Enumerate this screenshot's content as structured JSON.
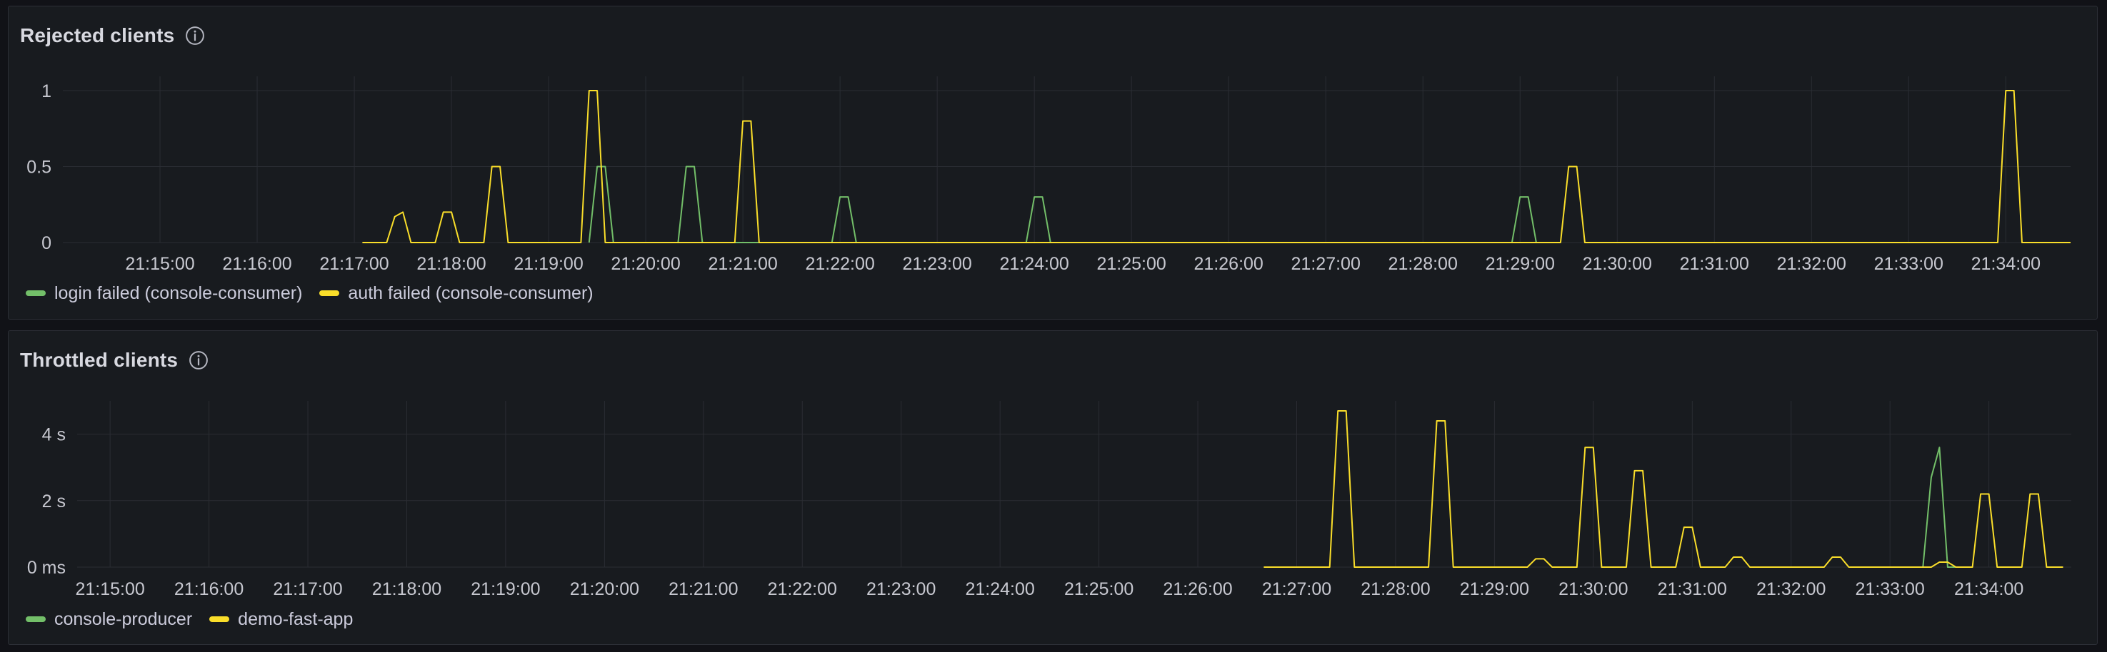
{
  "colors": {
    "background": "#111217",
    "panel": "#181b1f",
    "grid": "#2a2d33",
    "text": "#c7c8d0",
    "green": "#73bf69",
    "yellow": "#fade2a"
  },
  "panels": [
    {
      "id": "rejected",
      "title": "Rejected clients",
      "legend": [
        {
          "label": "login failed (console-consumer)",
          "color": "#73bf69"
        },
        {
          "label": "auth failed (console-consumer)",
          "color": "#fade2a"
        }
      ]
    },
    {
      "id": "throttled",
      "title": "Throttled clients",
      "legend": [
        {
          "label": "console-producer",
          "color": "#73bf69"
        },
        {
          "label": "demo-fast-app",
          "color": "#fade2a"
        }
      ]
    }
  ],
  "chart_data": [
    {
      "type": "line",
      "title": "Rejected clients",
      "x_range": [
        "21:14:00",
        "21:34:40"
      ],
      "x_ticks": [
        "21:15:00",
        "21:16:00",
        "21:17:00",
        "21:18:00",
        "21:19:00",
        "21:20:00",
        "21:21:00",
        "21:22:00",
        "21:23:00",
        "21:24:00",
        "21:25:00",
        "21:26:00",
        "21:27:00",
        "21:28:00",
        "21:29:00",
        "21:30:00",
        "21:31:00",
        "21:32:00",
        "21:33:00",
        "21:34:00"
      ],
      "y_ticks": [
        "0",
        "0.5",
        "1"
      ],
      "ylim": [
        0,
        1
      ],
      "grid": true,
      "legend_position": "bottom-left",
      "series": [
        {
          "name": "login failed (console-consumer)",
          "color": "#73bf69",
          "points": [
            [
              "21:19:25",
              0
            ],
            [
              "21:19:30",
              0.5
            ],
            [
              "21:19:35",
              0.5
            ],
            [
              "21:19:40",
              0
            ],
            [
              "21:20:20",
              0
            ],
            [
              "21:20:25",
              0.5
            ],
            [
              "21:20:30",
              0.5
            ],
            [
              "21:20:35",
              0
            ],
            [
              "21:21:55",
              0
            ],
            [
              "21:22:00",
              0.3
            ],
            [
              "21:22:05",
              0.3
            ],
            [
              "21:22:10",
              0
            ],
            [
              "21:23:55",
              0
            ],
            [
              "21:24:00",
              0.3
            ],
            [
              "21:24:05",
              0.3
            ],
            [
              "21:24:10",
              0
            ],
            [
              "21:28:55",
              0
            ],
            [
              "21:29:00",
              0.3
            ],
            [
              "21:29:05",
              0.3
            ],
            [
              "21:29:10",
              0
            ]
          ]
        },
        {
          "name": "auth failed (console-consumer)",
          "color": "#fade2a",
          "points": [
            [
              "21:17:05",
              0
            ],
            [
              "21:17:20",
              0
            ],
            [
              "21:17:25",
              0.17
            ],
            [
              "21:17:30",
              0.2
            ],
            [
              "21:17:35",
              0
            ],
            [
              "21:17:50",
              0
            ],
            [
              "21:17:55",
              0.2
            ],
            [
              "21:18:00",
              0.2
            ],
            [
              "21:18:05",
              0
            ],
            [
              "21:18:20",
              0
            ],
            [
              "21:18:25",
              0.5
            ],
            [
              "21:18:30",
              0.5
            ],
            [
              "21:18:35",
              0
            ],
            [
              "21:19:20",
              0
            ],
            [
              "21:19:25",
              1
            ],
            [
              "21:19:30",
              1
            ],
            [
              "21:19:35",
              0
            ],
            [
              "21:20:55",
              0
            ],
            [
              "21:21:00",
              0.8
            ],
            [
              "21:21:05",
              0.8
            ],
            [
              "21:21:10",
              0
            ],
            [
              "21:29:25",
              0
            ],
            [
              "21:29:30",
              0.5
            ],
            [
              "21:29:35",
              0.5
            ],
            [
              "21:29:40",
              0
            ],
            [
              "21:33:55",
              0
            ],
            [
              "21:34:00",
              1
            ],
            [
              "21:34:05",
              1
            ],
            [
              "21:34:10",
              0
            ],
            [
              "21:34:40",
              0
            ]
          ]
        }
      ]
    },
    {
      "type": "line",
      "title": "Throttled clients",
      "x_range": [
        "21:14:40",
        "21:34:50"
      ],
      "x_ticks": [
        "21:15:00",
        "21:16:00",
        "21:17:00",
        "21:18:00",
        "21:19:00",
        "21:20:00",
        "21:21:00",
        "21:22:00",
        "21:23:00",
        "21:24:00",
        "21:25:00",
        "21:26:00",
        "21:27:00",
        "21:28:00",
        "21:29:00",
        "21:30:00",
        "21:31:00",
        "21:32:00",
        "21:33:00",
        "21:34:00"
      ],
      "y_ticks": [
        "0 ms",
        "2 s",
        "4 s"
      ],
      "ylim": [
        0,
        5
      ],
      "y_unit": "s",
      "grid": true,
      "legend_position": "bottom-left",
      "series": [
        {
          "name": "console-producer",
          "color": "#73bf69",
          "points": [
            [
              "21:33:00",
              0
            ],
            [
              "21:33:20",
              0
            ],
            [
              "21:33:25",
              2.7
            ],
            [
              "21:33:30",
              3.6
            ],
            [
              "21:33:35",
              0
            ],
            [
              "21:33:40",
              0
            ]
          ]
        },
        {
          "name": "demo-fast-app",
          "color": "#fade2a",
          "points": [
            [
              "21:26:40",
              0
            ],
            [
              "21:27:10",
              0
            ],
            [
              "21:27:15",
              0
            ],
            [
              "21:27:20",
              0
            ],
            [
              "21:27:25",
              4.7
            ],
            [
              "21:27:30",
              4.7
            ],
            [
              "21:27:35",
              0
            ],
            [
              "21:28:20",
              0
            ],
            [
              "21:28:25",
              4.4
            ],
            [
              "21:28:30",
              4.4
            ],
            [
              "21:28:35",
              0
            ],
            [
              "21:29:20",
              0
            ],
            [
              "21:29:25",
              0.25
            ],
            [
              "21:29:30",
              0.25
            ],
            [
              "21:29:35",
              0
            ],
            [
              "21:29:50",
              0
            ],
            [
              "21:29:55",
              3.6
            ],
            [
              "21:30:00",
              3.6
            ],
            [
              "21:30:05",
              0
            ],
            [
              "21:30:20",
              0
            ],
            [
              "21:30:25",
              2.9
            ],
            [
              "21:30:30",
              2.9
            ],
            [
              "21:30:35",
              0
            ],
            [
              "21:30:50",
              0
            ],
            [
              "21:30:55",
              1.2
            ],
            [
              "21:31:00",
              1.2
            ],
            [
              "21:31:05",
              0
            ],
            [
              "21:31:20",
              0
            ],
            [
              "21:31:25",
              0.3
            ],
            [
              "21:31:30",
              0.3
            ],
            [
              "21:31:35",
              0
            ],
            [
              "21:32:20",
              0
            ],
            [
              "21:32:25",
              0.3
            ],
            [
              "21:32:30",
              0.3
            ],
            [
              "21:32:35",
              0
            ],
            [
              "21:33:25",
              0
            ],
            [
              "21:33:30",
              0.15
            ],
            [
              "21:33:35",
              0.15
            ],
            [
              "21:33:40",
              0
            ],
            [
              "21:33:50",
              0
            ],
            [
              "21:33:55",
              2.2
            ],
            [
              "21:34:00",
              2.2
            ],
            [
              "21:34:05",
              0
            ],
            [
              "21:34:20",
              0
            ],
            [
              "21:34:25",
              2.2
            ],
            [
              "21:34:30",
              2.2
            ],
            [
              "21:34:35",
              0
            ],
            [
              "21:34:45",
              0
            ]
          ]
        }
      ]
    }
  ]
}
